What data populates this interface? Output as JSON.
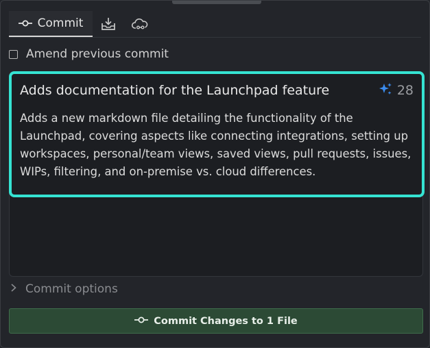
{
  "tabs": {
    "commit_label": "Commit",
    "icons": [
      "commit-icon",
      "stash-icon",
      "cloud-patch-icon"
    ]
  },
  "amend": {
    "label": "Amend previous commit",
    "checked": false
  },
  "message": {
    "summary": "Adds documentation for the Launchpad feature",
    "char_count": "28",
    "description": "Adds a new markdown file detailing the functionality of the Launchpad, covering aspects like connecting integrations, setting up workspaces, personal/team views, saved views, pull requests, issues, WIPs, filtering, and on-premise vs. cloud differences."
  },
  "options": {
    "label": "Commit options"
  },
  "commit_button": {
    "label": "Commit Changes to 1 File"
  },
  "colors": {
    "highlight_border": "#35e3d2",
    "commit_button_bg": "#2c4a35",
    "sparkle": "#3b8df0"
  }
}
